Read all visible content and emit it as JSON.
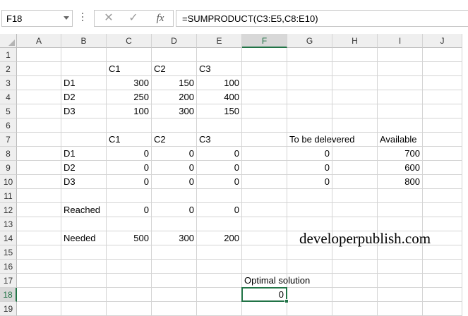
{
  "formula_bar": {
    "name_box": "F18",
    "cancel_icon": "✕",
    "enter_icon": "✓",
    "fx_label": "fx",
    "formula": "=SUMPRODUCT(C3:E5,C8:E10)"
  },
  "columns": [
    "A",
    "B",
    "C",
    "D",
    "E",
    "F",
    "G",
    "H",
    "I",
    "J"
  ],
  "rows": [
    "1",
    "2",
    "3",
    "4",
    "5",
    "6",
    "7",
    "8",
    "9",
    "10",
    "11",
    "12",
    "13",
    "14",
    "15",
    "16",
    "17",
    "18",
    "19"
  ],
  "active_cell": "F18",
  "cells": {
    "C2": "C1",
    "D2": "C2",
    "E2": "C3",
    "B3": "D1",
    "C3": "300",
    "D3": "150",
    "E3": "100",
    "B4": "D2",
    "C4": "250",
    "D4": "200",
    "E4": "400",
    "B5": "D3",
    "C5": "100",
    "D5": "300",
    "E5": "150",
    "C7": "C1",
    "D7": "C2",
    "E7": "C3",
    "G7": "To be delevered",
    "I7": "Available",
    "B8": "D1",
    "C8": "0",
    "D8": "0",
    "E8": "0",
    "G8": "0",
    "I8": "700",
    "B9": "D2",
    "C9": "0",
    "D9": "0",
    "E9": "0",
    "G9": "0",
    "I9": "600",
    "B10": "D3",
    "C10": "0",
    "D10": "0",
    "E10": "0",
    "G10": "0",
    "I10": "800",
    "B12": "Reached",
    "C12": "0",
    "D12": "0",
    "E12": "0",
    "B14": "Needed",
    "C14": "500",
    "D14": "300",
    "E14": "200",
    "F17": "Optimal solution",
    "F18": "0"
  },
  "watermark": "developerpublish.com",
  "colors": {
    "accent": "#217346",
    "header_bg": "#efefef",
    "gridline": "#d4d4d4"
  }
}
